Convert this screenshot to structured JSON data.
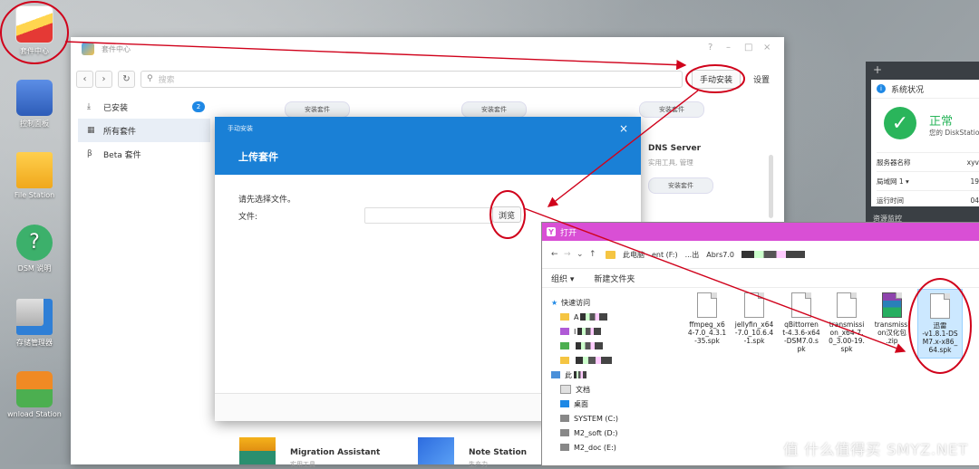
{
  "desktop": {
    "icons": [
      {
        "label": "套件中心"
      },
      {
        "label": "控制面板"
      },
      {
        "label": "File Station"
      },
      {
        "label": "DSM 说明"
      },
      {
        "label": "存储管理器"
      },
      {
        "label": "wnload Station"
      }
    ],
    "watermark": "值 什么值得买 SMYZ.NET"
  },
  "package_center": {
    "title": "套件中心",
    "window_controls": [
      "?",
      "–",
      "□",
      "×"
    ],
    "search_placeholder": "搜索",
    "manual_install_label": "手动安装",
    "settings_label": "设置",
    "sidebar": [
      {
        "label": "已安装",
        "icon": "download-icon",
        "badge": "2"
      },
      {
        "label": "所有套件",
        "icon": "grid-icon"
      },
      {
        "label": "Beta 套件",
        "icon": "beta-icon"
      }
    ],
    "install_label": "安装套件",
    "dns_server": {
      "name": "DNS Server",
      "category": "实用工具, 管理"
    },
    "bottom_packages": [
      {
        "name": "Migration Assistant",
        "category": "实用工具"
      },
      {
        "name": "Note Station",
        "category": "生产力"
      }
    ]
  },
  "manual_install": {
    "header_small": "手动安装",
    "header_title": "上传套件",
    "close": "×",
    "prompt": "请先选择文件。",
    "file_label": "文件:",
    "file_value": "",
    "browse_label": "浏览"
  },
  "file_dialog": {
    "title": "打开",
    "nav": [
      "←",
      "→",
      "⌄",
      "↑"
    ],
    "address": [
      "此电脑",
      "ent (F:)",
      "...出",
      "Abrs7.0"
    ],
    "organize_label": "组织 ▾",
    "new_folder_label": "新建文件夹",
    "tree": [
      {
        "label": "快速访问"
      },
      {
        "label": "A"
      },
      {
        "label": "I"
      },
      {
        "label": ""
      },
      {
        "label": ""
      },
      {
        "label": "此"
      },
      {
        "label": "文档"
      },
      {
        "label": "桌面"
      },
      {
        "label": "SYSTEM (C:)"
      },
      {
        "label": "M2_soft (D:)"
      },
      {
        "label": "M2_doc (E:)"
      }
    ],
    "files": [
      {
        "name": "ffmpeg_x64-7.0_4.3.1-35.spk",
        "lines": [
          "ffmpeg_x6",
          "4-7.0_4.3.1",
          "-35.spk"
        ]
      },
      {
        "name": "jellyfin_x64-7.0_10.6.4-1.spk",
        "lines": [
          "jellyfin_x64",
          "-7.0_10.6.4",
          "-1.spk"
        ]
      },
      {
        "name": "qBittorrent-4.3.6-x64-DSM7.0.spk",
        "lines": [
          "qBittorren",
          "t-4.3.6-x64",
          "-DSM7.0.s",
          "pk"
        ]
      },
      {
        "name": "transmission_x64-7.0_3.00-19.spk",
        "lines": [
          "transmissi",
          "on_x64-7.",
          "0_3.00-19.",
          "spk"
        ]
      },
      {
        "name": "transmission汉化包.zip",
        "lines": [
          "transmissi",
          "on汉化包",
          ".zip"
        ]
      },
      {
        "name": "迅雷-v1.8.1-DSM7.x-x86_64.spk",
        "lines": [
          "迅雷",
          "-v1.8.1-DS",
          "M7.x-x86_",
          "64.spk"
        ]
      }
    ]
  },
  "status_panel": {
    "title": "系统状况",
    "status": "正常",
    "sub": "您的 DiskStatio",
    "rows": [
      {
        "label": "服务器名称",
        "value": "xyv"
      },
      {
        "label": "局域网 1 ▾",
        "value": "19"
      },
      {
        "label": "运行时间",
        "value": "04"
      }
    ],
    "resource_title": "资源监控"
  },
  "colors": {
    "dialog_blue": "#1a80d6",
    "file_dialog_title": "#d94fd5",
    "annotation_red": "#d0021b",
    "status_green": "#2ab55b",
    "badge_blue": "#1e88e5"
  }
}
